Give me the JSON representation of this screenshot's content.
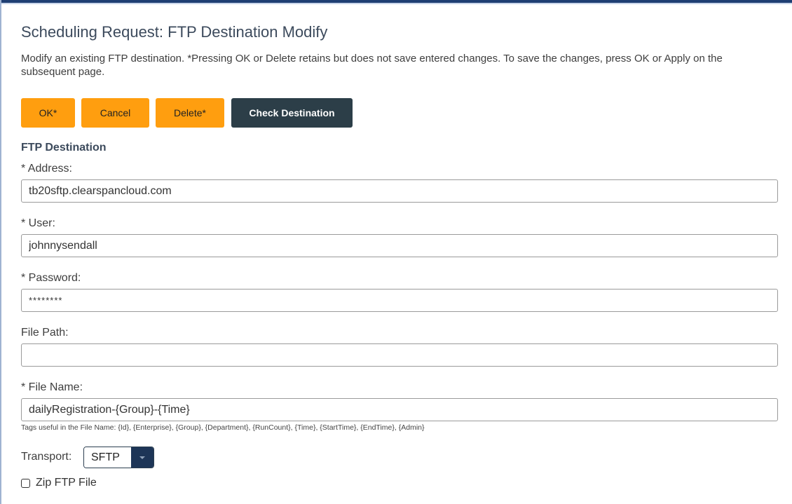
{
  "page": {
    "title": "Scheduling Request: FTP Destination Modify",
    "description": "Modify an existing FTP destination. *Pressing OK or Delete retains but does not save entered changes. To save the changes, press OK or Apply on the subsequent page."
  },
  "toolbar": {
    "ok_label": "OK*",
    "cancel_label": "Cancel",
    "delete_label": "Delete*",
    "check_label": "Check Destination"
  },
  "form": {
    "section_title": "FTP Destination",
    "address": {
      "label": "* Address:",
      "value": "tb20sftp.clearspancloud.com"
    },
    "user": {
      "label": "* User:",
      "value": "johnnysendall"
    },
    "password": {
      "label": "* Password:",
      "value": "********"
    },
    "file_path": {
      "label": "File Path:",
      "value": ""
    },
    "file_name": {
      "label": "* File Name:",
      "value": "dailyRegistration-{Group}-{Time}"
    },
    "file_name_hint": "Tags useful in the File Name:  {Id}, {Enterprise}, {Group}, {Department}, {RunCount}, {Time}, {StartTime}, {EndTime}, {Admin}",
    "transport": {
      "label": "Transport:",
      "selected": "SFTP"
    },
    "zip": {
      "label": "Zip FTP File",
      "checked": false
    }
  },
  "colors": {
    "primary_button": "#ff9e0f",
    "dark_button": "#2c3e48",
    "header_rule": "#1f3f73",
    "select_caret_bg": "#1d3557"
  },
  "icons": {
    "select_caret": "chevron-down-icon",
    "checkbox": "checkbox-icon"
  }
}
